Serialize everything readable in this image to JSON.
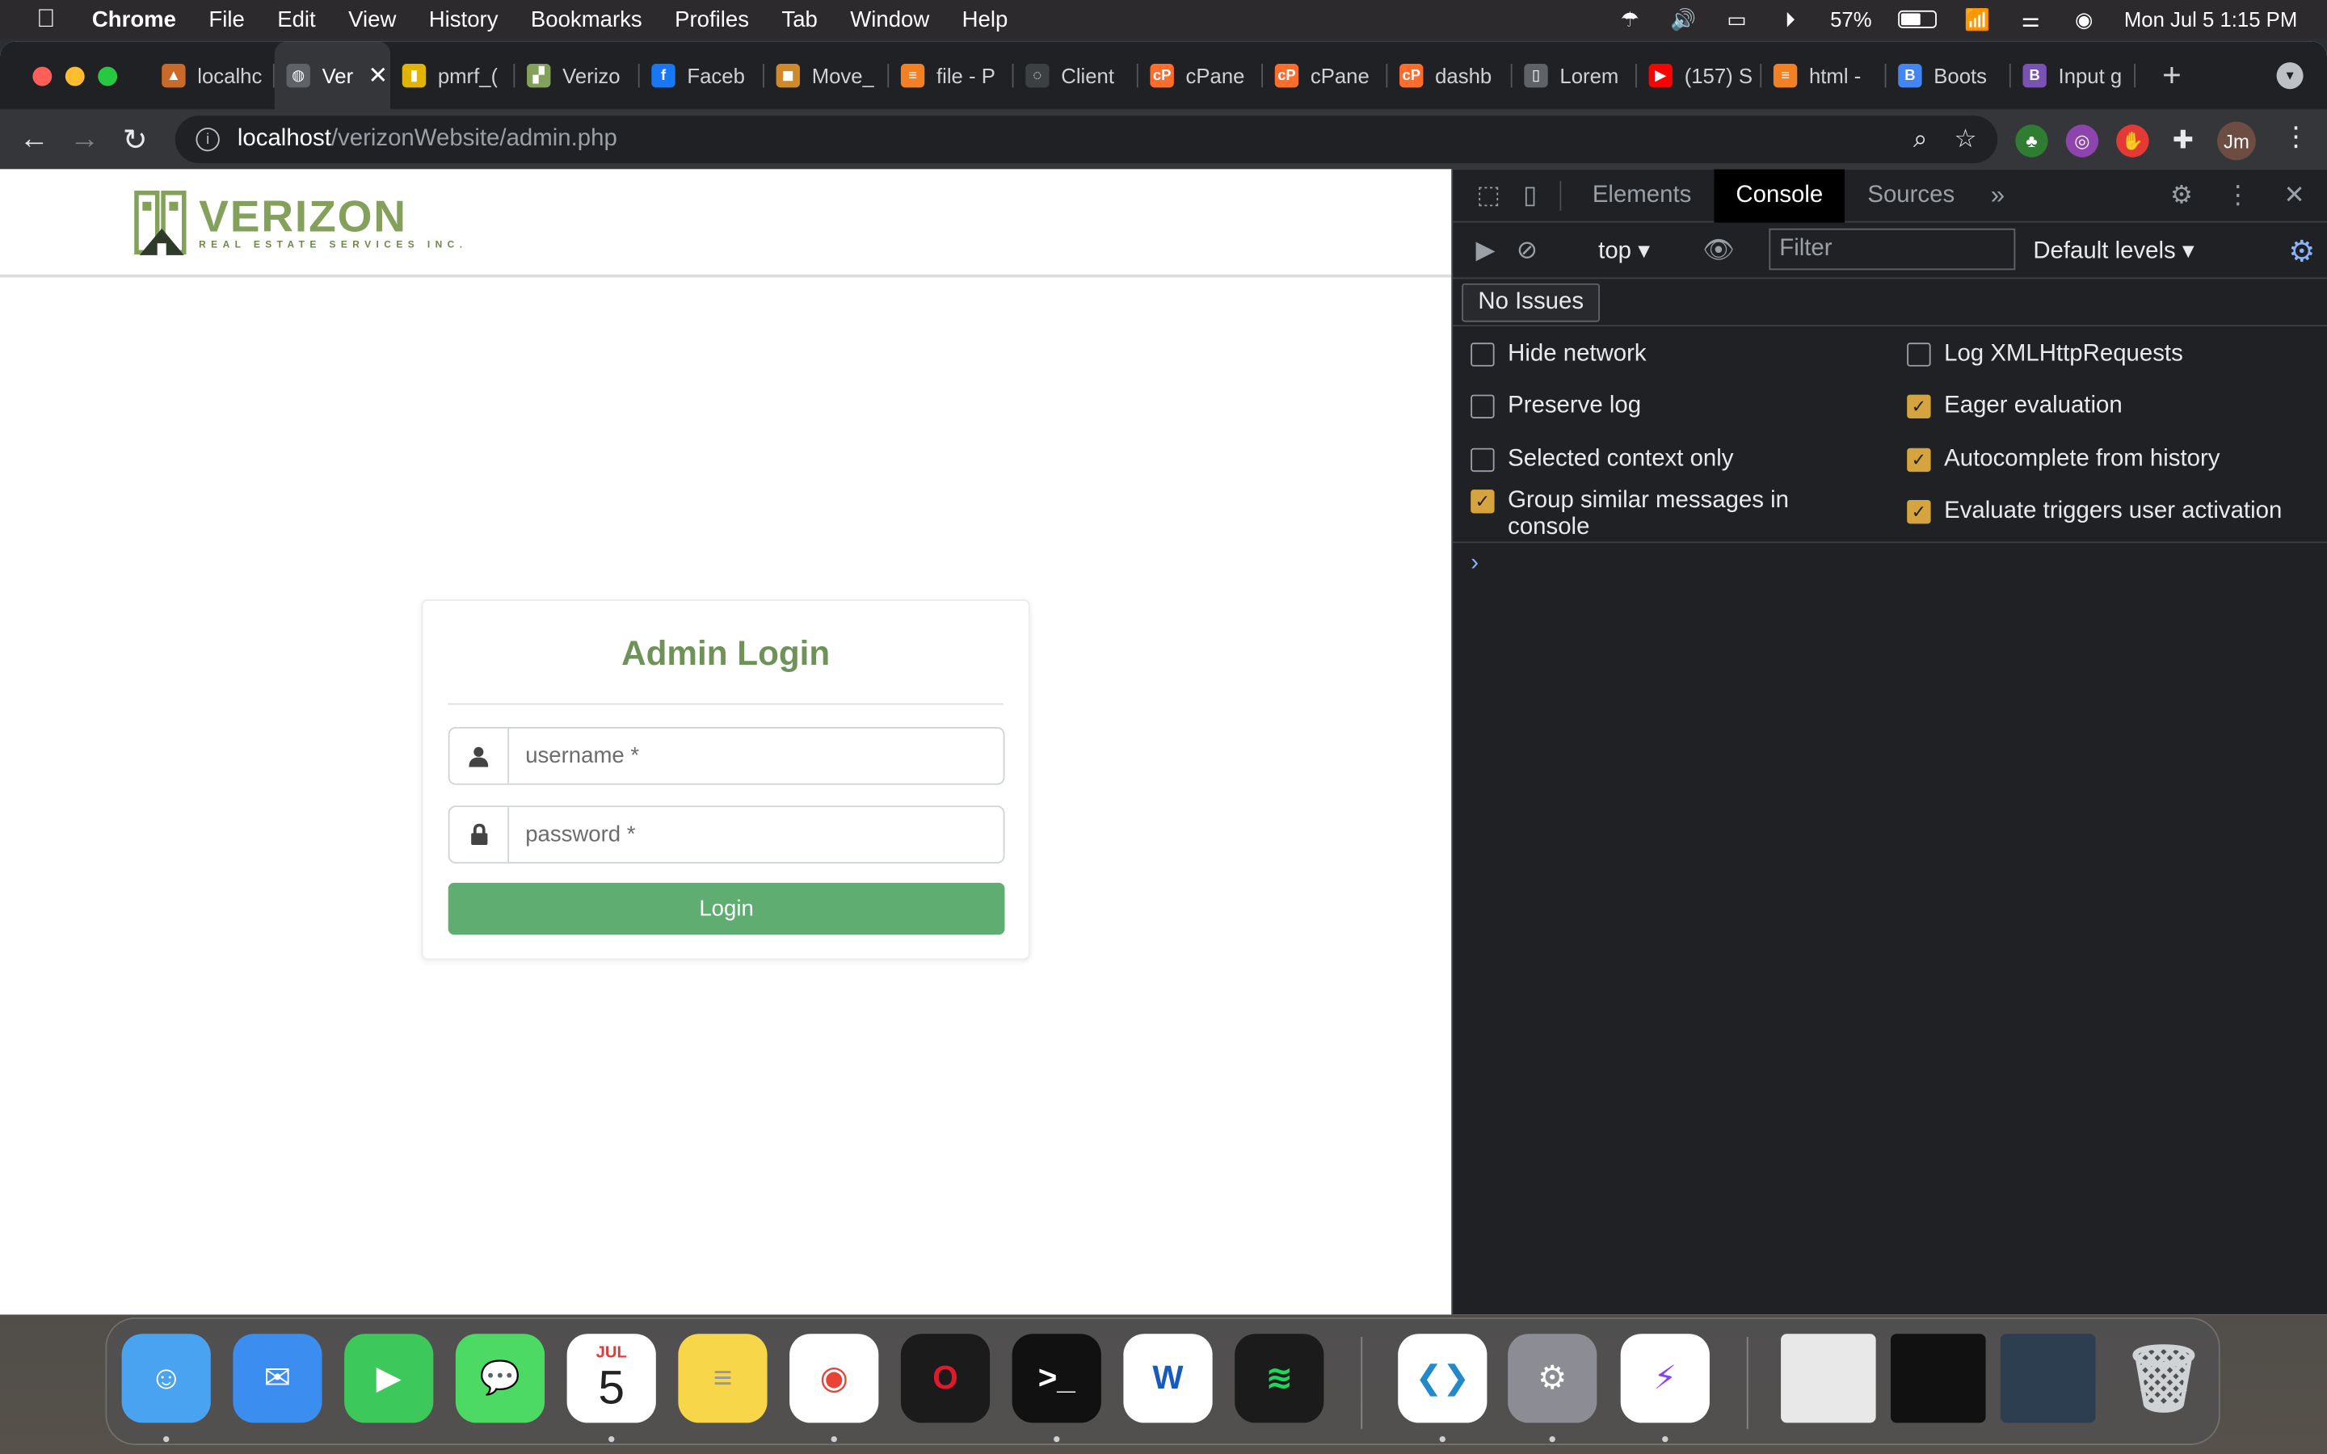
{
  "menubar": {
    "app": "Chrome",
    "menus": [
      "File",
      "Edit",
      "View",
      "History",
      "Bookmarks",
      "Profiles",
      "Tab",
      "Window",
      "Help"
    ],
    "battery": "57%",
    "clock": "Mon Jul 5  1:15 PM"
  },
  "tabs": [
    {
      "title": "localhc",
      "favicon_color": "#c96a2b",
      "favicon_glyph": "▲"
    },
    {
      "title": "Ver",
      "favicon_color": "#5f6368",
      "favicon_glyph": "◍",
      "active": true
    },
    {
      "title": "pmrf_(",
      "favicon_color": "#e0b400",
      "favicon_glyph": "▮"
    },
    {
      "title": "Verizo",
      "favicon_color": "#83a15b",
      "favicon_glyph": "▞"
    },
    {
      "title": "Faceb",
      "favicon_color": "#1877f2",
      "favicon_glyph": "f"
    },
    {
      "title": "Move_",
      "favicon_color": "#d08a2a",
      "favicon_glyph": "◼"
    },
    {
      "title": "file - P",
      "favicon_color": "#f48024",
      "favicon_glyph": "≡"
    },
    {
      "title": "Client",
      "favicon_color": "#3c4043",
      "favicon_glyph": "◌"
    },
    {
      "title": "cPane",
      "favicon_color": "#ff6c2c",
      "favicon_glyph": "cP"
    },
    {
      "title": "cPane",
      "favicon_color": "#ff6c2c",
      "favicon_glyph": "cP"
    },
    {
      "title": "dashb",
      "favicon_color": "#ff6c2c",
      "favicon_glyph": "cP"
    },
    {
      "title": "Lorem",
      "favicon_color": "#5f6368",
      "favicon_glyph": "▯"
    },
    {
      "title": "(157) S",
      "favicon_color": "#ff0000",
      "favicon_glyph": "▶"
    },
    {
      "title": "html -",
      "favicon_color": "#f48024",
      "favicon_glyph": "≡"
    },
    {
      "title": "Boots",
      "favicon_color": "#4285f4",
      "favicon_glyph": "B"
    },
    {
      "title": "Input g",
      "favicon_color": "#7952b3",
      "favicon_glyph": "B"
    }
  ],
  "omnibox": {
    "host": "localhost",
    "path": "/verizonWebsite/admin.php"
  },
  "profile_initials": "Jm",
  "site": {
    "logo_word": "VERIZON",
    "logo_sub": "REAL ESTATE SERVICES INC.",
    "brand_color": "#83a15b"
  },
  "login": {
    "title": "Admin Login",
    "username_placeholder": "username *",
    "password_placeholder": "password *",
    "button_label": "Login",
    "button_color": "#5fad71"
  },
  "devtools": {
    "tabs": [
      "Elements",
      "Console",
      "Sources"
    ],
    "active_tab": "Console",
    "context": "top",
    "filter_placeholder": "Filter",
    "levels": "Default levels",
    "issues": "No Issues",
    "options_left": [
      {
        "label": "Hide network",
        "checked": false
      },
      {
        "label": "Preserve log",
        "checked": false
      },
      {
        "label": "Selected context only",
        "checked": false
      },
      {
        "label": "Group similar messages in console",
        "checked": true
      }
    ],
    "options_right": [
      {
        "label": "Log XMLHttpRequests",
        "checked": false
      },
      {
        "label": "Eager evaluation",
        "checked": true
      },
      {
        "label": "Autocomplete from history",
        "checked": true
      },
      {
        "label": "Evaluate triggers user activation",
        "checked": true
      }
    ],
    "prompt_glyph": "›"
  },
  "dock": {
    "apps": [
      {
        "name": "finder-icon",
        "label": "Finder",
        "color": "#4aa3f0",
        "running": true
      },
      {
        "name": "mail-icon",
        "label": "Mail",
        "color": "#3b8ef0",
        "running": false
      },
      {
        "name": "facetime-icon",
        "label": "FaceTime",
        "color": "#3cc85a",
        "running": false
      },
      {
        "name": "messages-icon",
        "label": "Messages",
        "color": "#4cd964",
        "running": false
      },
      {
        "name": "calendar-icon",
        "label": "Calendar",
        "color": "#ffffff",
        "running": true
      },
      {
        "name": "notes-icon",
        "label": "Notes",
        "color": "#f7d64a",
        "running": false
      },
      {
        "name": "chrome-icon",
        "label": "Chrome",
        "color": "#ffffff",
        "running": true
      },
      {
        "name": "opera-icon",
        "label": "Opera",
        "color": "#1b1b1b",
        "running": false
      },
      {
        "name": "terminal-icon",
        "label": "Terminal",
        "color": "#111111",
        "running": true
      },
      {
        "name": "word-icon",
        "label": "Word",
        "color": "#ffffff",
        "running": false
      },
      {
        "name": "spotify-icon",
        "label": "Spotify",
        "color": "#1b1b1b",
        "running": false
      },
      {
        "name": "vscode-icon",
        "label": "VS Code",
        "color": "#ffffff",
        "running": true
      },
      {
        "name": "system-preferences-icon",
        "label": "System Preferences",
        "color": "#8c8c94",
        "running": true
      },
      {
        "name": "messenger-icon",
        "label": "Messenger",
        "color": "#ffffff",
        "running": true
      }
    ],
    "calendar_month": "JUL",
    "calendar_day": "5"
  }
}
